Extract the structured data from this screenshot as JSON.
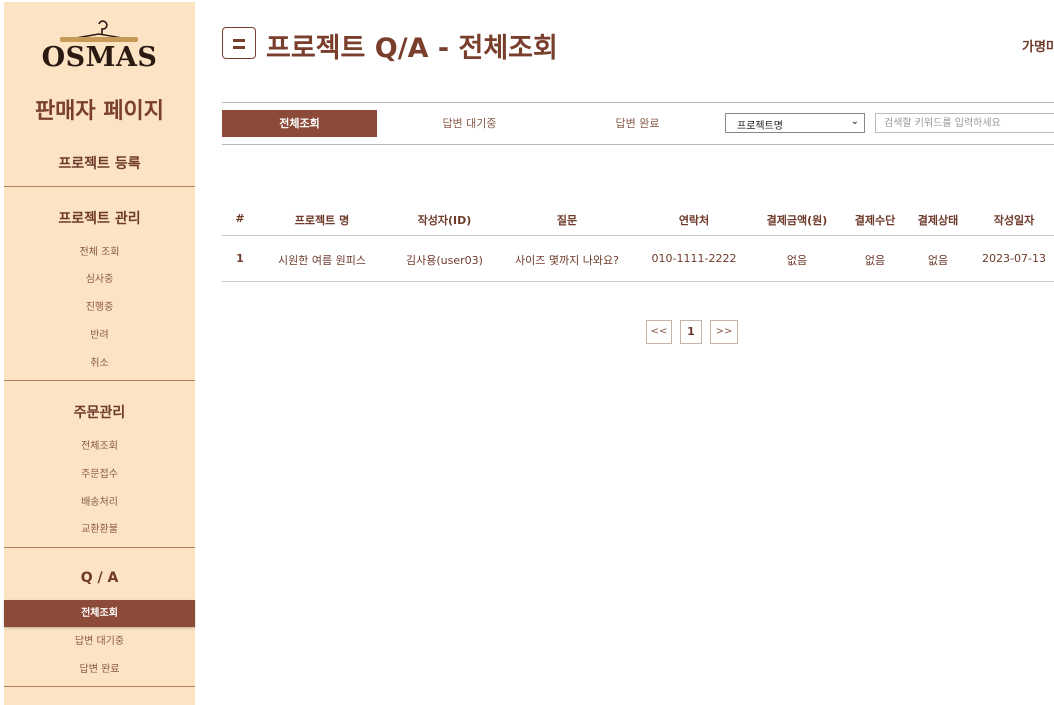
{
  "sidebar": {
    "logo_text": "OSMAS",
    "brand_title": "판매자 페이지",
    "register": "프로젝트 등록",
    "project_mgmt": {
      "title": "프로젝트 관리",
      "items": [
        "전체 조회",
        "심사중",
        "진행중",
        "반려",
        "취소"
      ]
    },
    "order_mgmt": {
      "title": "주문관리",
      "items": [
        "전체조회",
        "주문접수",
        "배송처리",
        "교환환불"
      ]
    },
    "qa": {
      "title": "Q / A",
      "items": [
        "전체조회",
        "답변 대기중",
        "답변 완료"
      ],
      "active_index": 0
    }
  },
  "header": {
    "title": "프로젝트 Q/A - 전체조회",
    "user_name": "가명미"
  },
  "filters": {
    "tabs": [
      "전체조회",
      "답변 대기중",
      "답변 완료"
    ],
    "active_tab": 0,
    "select_value": "프로젝트명",
    "search_placeholder": "검색할 키워드를 입력하세요"
  },
  "table": {
    "columns": [
      "#",
      "프로젝트 명",
      "작성자(ID)",
      "질문",
      "연락처",
      "결제금액(원)",
      "결제수단",
      "결제상태",
      "작성일자"
    ],
    "rows": [
      [
        "1",
        "시원한 여름 원피스",
        "김사용(user03)",
        "사이즈 몇까지 나와요?",
        "010-1111-2222",
        "없음",
        "없음",
        "없음",
        "2023-07-13"
      ]
    ]
  },
  "pagination": {
    "prev": "<<",
    "pages": [
      "1"
    ],
    "next": ">>"
  },
  "colors": {
    "sidebar_bg": "#fbe3c4",
    "accent": "#8c4a38",
    "title": "#7a3e2c"
  }
}
